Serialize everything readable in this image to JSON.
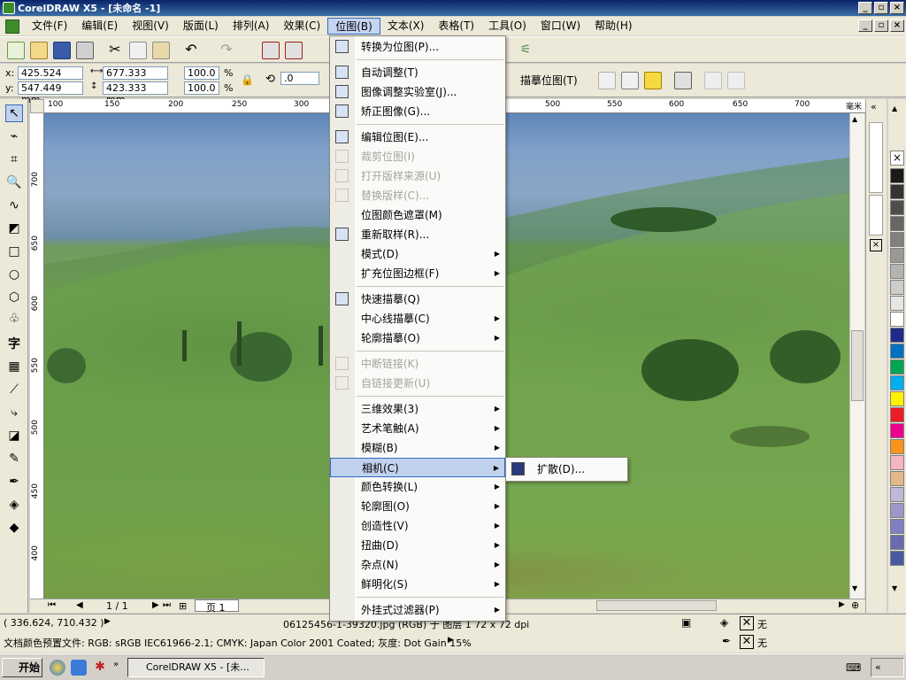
{
  "window": {
    "title": "CorelDRAW X5 - [未命名 -1]",
    "controls": [
      "_",
      "▫",
      "×"
    ]
  },
  "menubar": [
    "文件(F)",
    "编辑(E)",
    "视图(V)",
    "版面(L)",
    "排列(A)",
    "效果(C)",
    "位图(B)",
    "文本(X)",
    "表格(T)",
    "工具(O)",
    "窗口(W)",
    "帮助(H)"
  ],
  "propbar": {
    "x_label": "x:",
    "x_value": "425.524 mm",
    "y_label": "y:",
    "y_value": "547.449 mm",
    "w_value": "677.333 mm",
    "h_value": "423.333 mm",
    "scale_x": "100.0",
    "scale_y": "100.0",
    "percent": "%",
    "angle": ".0",
    "trace_label": "描摹位图(T)"
  },
  "ruler_h": [
    "100",
    "150",
    "200",
    "250",
    "300",
    "500",
    "550",
    "600",
    "650",
    "700",
    "毫米"
  ],
  "ruler_v": [
    "700",
    "650",
    "600",
    "550",
    "500",
    "450",
    "400"
  ],
  "menu": {
    "items": [
      {
        "label": "转换为位图(P)...",
        "icon": "convert-bitmap-icon",
        "disabled": false,
        "submenu": false
      },
      {
        "sep": true
      },
      {
        "label": "自动调整(T)",
        "icon": "auto-adjust-icon",
        "disabled": false,
        "submenu": false
      },
      {
        "label": "图像调整实验室(J)...",
        "icon": "image-lab-icon",
        "disabled": false,
        "submenu": false
      },
      {
        "label": "矫正图像(G)...",
        "icon": "straighten-icon",
        "disabled": false,
        "submenu": false
      },
      {
        "sep": true
      },
      {
        "label": "编辑位图(E)...",
        "icon": "edit-bitmap-icon",
        "disabled": false,
        "submenu": false
      },
      {
        "label": "裁剪位图(I)",
        "icon": "crop-bitmap-icon",
        "disabled": true,
        "submenu": false
      },
      {
        "label": "打开版样来源(U)",
        "icon": "open-source-icon",
        "disabled": true,
        "submenu": false
      },
      {
        "label": "替换版样(C)...",
        "icon": "replace-icon",
        "disabled": true,
        "submenu": false
      },
      {
        "label": "位图颜色遮罩(M)",
        "icon": "",
        "disabled": false,
        "submenu": false
      },
      {
        "label": "重新取样(R)...",
        "icon": "resample-icon",
        "disabled": false,
        "submenu": false
      },
      {
        "label": "模式(D)",
        "icon": "",
        "disabled": false,
        "submenu": true
      },
      {
        "label": "扩充位图边框(F)",
        "icon": "",
        "disabled": false,
        "submenu": true
      },
      {
        "sep": true
      },
      {
        "label": "快速描摹(Q)",
        "icon": "quick-trace-icon",
        "disabled": false,
        "submenu": false
      },
      {
        "label": "中心线描摹(C)",
        "icon": "",
        "disabled": false,
        "submenu": true
      },
      {
        "label": "轮廓描摹(O)",
        "icon": "",
        "disabled": false,
        "submenu": true
      },
      {
        "sep": true
      },
      {
        "label": "中断链接(K)",
        "icon": "break-link-icon",
        "disabled": true,
        "submenu": false
      },
      {
        "label": "自链接更新(U)",
        "icon": "update-link-icon",
        "disabled": true,
        "submenu": false
      },
      {
        "sep": true
      },
      {
        "label": "三维效果(3)",
        "icon": "",
        "disabled": false,
        "submenu": true
      },
      {
        "label": "艺术笔触(A)",
        "icon": "",
        "disabled": false,
        "submenu": true
      },
      {
        "label": "模糊(B)",
        "icon": "",
        "disabled": false,
        "submenu": true
      },
      {
        "label": "相机(C)",
        "icon": "",
        "disabled": false,
        "submenu": true,
        "highlighted": true
      },
      {
        "label": "颜色转换(L)",
        "icon": "",
        "disabled": false,
        "submenu": true
      },
      {
        "label": "轮廓图(O)",
        "icon": "",
        "disabled": false,
        "submenu": true
      },
      {
        "label": "创造性(V)",
        "icon": "",
        "disabled": false,
        "submenu": true
      },
      {
        "label": "扭曲(D)",
        "icon": "",
        "disabled": false,
        "submenu": true
      },
      {
        "label": "杂点(N)",
        "icon": "",
        "disabled": false,
        "submenu": true
      },
      {
        "label": "鲜明化(S)",
        "icon": "",
        "disabled": false,
        "submenu": true
      },
      {
        "sep": true
      },
      {
        "label": "外挂式过滤器(P)",
        "icon": "",
        "disabled": false,
        "submenu": true
      }
    ]
  },
  "submenu": {
    "label": "扩散(D)...",
    "icon": "diffuse-icon"
  },
  "page_nav": {
    "page_count": "1 / 1",
    "page_tab": "页 1"
  },
  "status": {
    "coords": "( 336.624, 710.432 )",
    "info": "06125456-1-39320.jpg (RGB) 于 图层 1 72 x 72 dpi",
    "profiles": "文档颜色预置文件: RGB: sRGB IEC61966-2.1; CMYK: Japan Color 2001 Coated; 灰度: Dot Gain 15%",
    "fill_none": "无",
    "outline_none": "无"
  },
  "taskbar": {
    "start": "开始",
    "task": "CorelDRAW X5 - [未..."
  },
  "palette_colors": [
    "#ffffff",
    "#1a1a1a",
    "#333333",
    "#4d4d4d",
    "#666666",
    "#808080",
    "#999999",
    "#b3b3b3",
    "#cccccc",
    "#e6e6e6",
    "#ffffff",
    "#1f2a8a",
    "#0070c0",
    "#00a651",
    "#00aeef",
    "#fff200",
    "#ed1c24",
    "#ec008c",
    "#f7941d",
    "#f4b6c2",
    "#e2b88a",
    "#c0b8d8",
    "#9b98c8",
    "#8080c0",
    "#6a6aae",
    "#4a5aa0"
  ]
}
